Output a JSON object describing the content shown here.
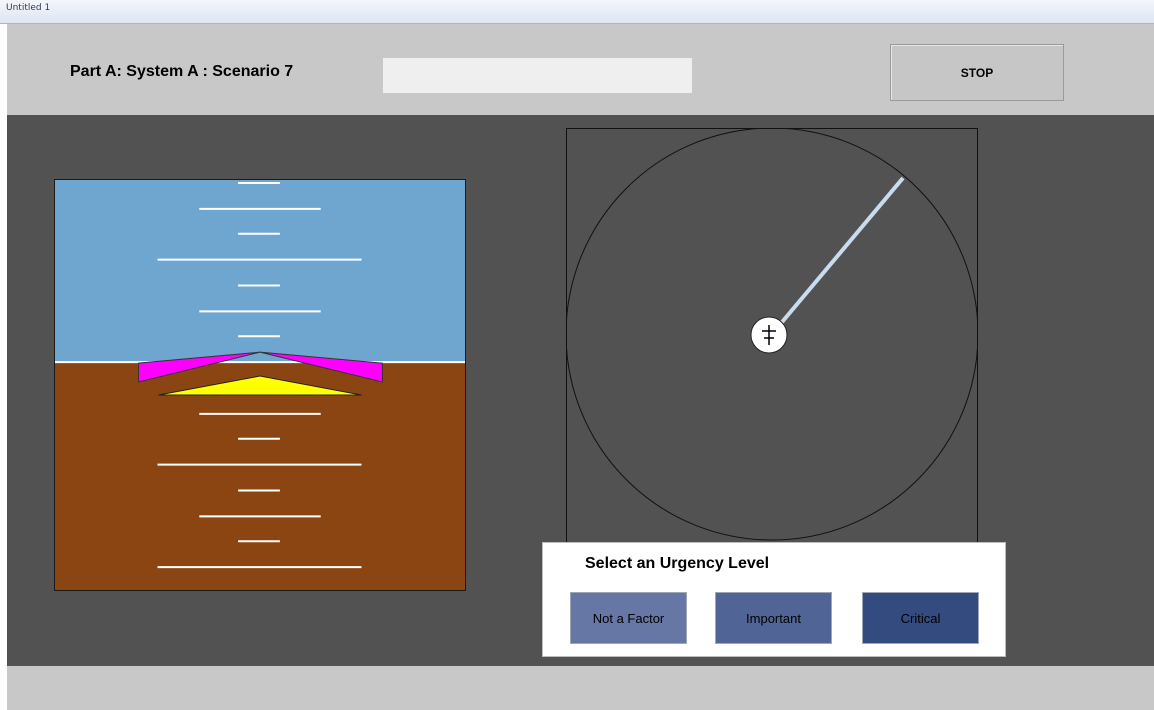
{
  "window": {
    "title": "Untitled 1"
  },
  "header": {
    "title": "Part A: System A : Scenario 7",
    "status_value": "",
    "stop_label": "STOP"
  },
  "colors": {
    "sky": "#6ea6cf",
    "ground": "#8b4513",
    "aircraft_wings": "#ff00ff",
    "aircraft_body": "#ffff00",
    "radar_sweep": "#c8dcf0"
  },
  "urgency": {
    "title": "Select an Urgency Level",
    "options": [
      {
        "label": "Not a Factor",
        "color": "#6677a6"
      },
      {
        "label": "Important",
        "color": "#506596"
      },
      {
        "label": "Critical",
        "color": "#344b80"
      }
    ]
  }
}
